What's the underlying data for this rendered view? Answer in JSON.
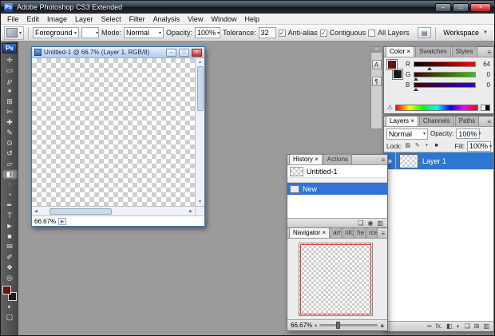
{
  "glyphs": {
    "minimize": "–",
    "maximize": "□",
    "close": "×",
    "dropdown": "▾",
    "dropdown_solid": "▼",
    "menu": "≡",
    "check": "✓",
    "warning": "⚠",
    "brushes": "▤",
    "eye": "◉",
    "status_arrow": "▶",
    "scroll_up": "▲",
    "scroll_down": "▼",
    "scroll_left": "◀",
    "scroll_right": "▶"
  },
  "window": {
    "title": "Adobe Photoshop CS3 Extended",
    "app_icon": "Ps"
  },
  "menu": {
    "items": [
      "File",
      "Edit",
      "Image",
      "Layer",
      "Select",
      "Filter",
      "Analysis",
      "View",
      "Window",
      "Help"
    ]
  },
  "options": {
    "fill_source": "Foreground",
    "mode_label": "Mode:",
    "mode_value": "Normal",
    "opacity_label": "Opacity:",
    "opacity_value": "100%",
    "tolerance_label": "Tolerance:",
    "tolerance_value": "32",
    "antialias": "Anti-alias",
    "contiguous": "Contiguous",
    "all_layers": "All Layers",
    "workspace": "Workspace"
  },
  "toolbar": {
    "logo": "Ps",
    "foreground_color": "#5e1616",
    "background_color": "#1c1c1c",
    "tools": [
      {
        "name": "move-tool",
        "glyph": "✛"
      },
      {
        "name": "marquee-tool",
        "glyph": "▭"
      },
      {
        "name": "lasso-tool",
        "glyph": "℘"
      },
      {
        "name": "magic-wand-tool",
        "glyph": "✶"
      },
      {
        "name": "crop-tool",
        "glyph": "⊞"
      },
      {
        "name": "slice-tool",
        "glyph": "✄"
      },
      {
        "name": "healing-brush-tool",
        "glyph": "✚"
      },
      {
        "name": "brush-tool",
        "glyph": "✎"
      },
      {
        "name": "clone-stamp-tool",
        "glyph": "⊙"
      },
      {
        "name": "history-brush-tool",
        "glyph": "↺"
      },
      {
        "name": "eraser-tool",
        "glyph": "▱"
      },
      {
        "name": "paint-bucket-tool",
        "glyph": "◧"
      },
      {
        "name": "blur-tool",
        "glyph": "◌"
      },
      {
        "name": "dodge-tool",
        "glyph": "◔"
      },
      {
        "name": "pen-tool",
        "glyph": "✒"
      },
      {
        "name": "type-tool",
        "glyph": "T"
      },
      {
        "name": "path-selection-tool",
        "glyph": "►"
      },
      {
        "name": "shape-tool",
        "glyph": "■"
      },
      {
        "name": "notes-tool",
        "glyph": "✉"
      },
      {
        "name": "eyedropper-tool",
        "glyph": "✐"
      },
      {
        "name": "hand-tool",
        "glyph": "❖"
      },
      {
        "name": "zoom-tool",
        "glyph": "◎"
      },
      {
        "name": "quick-mask-mode-icon",
        "glyph": "◐"
      },
      {
        "name": "screen-mode-icon",
        "glyph": "▢"
      }
    ]
  },
  "document": {
    "title": "Untitled-1 @ 66.7% (Layer 1, RGB/8)",
    "zoom": "66.67%"
  },
  "history": {
    "tab_active": "History ×",
    "tab_inactive": "Actions",
    "snapshot": "Untitled-1",
    "state": "New",
    "buttons": [
      {
        "name": "new-document-from-state-icon",
        "glyph": "❏"
      },
      {
        "name": "new-snapshot-icon",
        "glyph": "◉"
      },
      {
        "name": "delete-state-icon",
        "glyph": "▥"
      }
    ]
  },
  "navigator": {
    "tab_active": "Navigator ×",
    "tabs_truncated": [
      "am",
      "nfo",
      "he",
      "rce"
    ],
    "zoom": "66.67%",
    "zoom_out_glyph": "▴",
    "zoom_in_glyph": "▴"
  },
  "dock_strip": {
    "icons": [
      {
        "name": "collapse-dock-icon",
        "glyph": "«"
      },
      {
        "name": "character-panel-icon",
        "glyph": "A"
      },
      {
        "name": "paragraph-panel-icon",
        "glyph": "¶"
      }
    ]
  },
  "color_panel": {
    "tabs": [
      "Color ×",
      "Swatches",
      "Styles"
    ],
    "channels": [
      {
        "label": "R",
        "value": "64"
      },
      {
        "label": "G",
        "value": "0"
      },
      {
        "label": "B",
        "value": "0"
      }
    ]
  },
  "layers_panel": {
    "tabs": [
      "Layers ×",
      "Channels",
      "Paths"
    ],
    "blend_mode": "Normal",
    "opacity_label": "Opacity:",
    "opacity_value": "100%",
    "lock_label": "Lock:",
    "fill_label": "Fill:",
    "fill_value": "100%",
    "layer_name": "Layer 1",
    "locks": [
      {
        "name": "lock-transparency-icon",
        "glyph": "▨"
      },
      {
        "name": "lock-pixels-icon",
        "glyph": "✎"
      },
      {
        "name": "lock-position-icon",
        "glyph": "+"
      },
      {
        "name": "lock-all-icon",
        "glyph": "■"
      }
    ],
    "buttons": [
      {
        "name": "link-layers-icon",
        "glyph": "∞"
      },
      {
        "name": "layer-style-icon",
        "glyph": "fx."
      },
      {
        "name": "add-layer-mask-icon",
        "glyph": "◧"
      },
      {
        "name": "adjustment-layer-icon",
        "glyph": "◐"
      },
      {
        "name": "new-group-icon",
        "glyph": "❑"
      },
      {
        "name": "new-layer-icon",
        "glyph": "⊞"
      },
      {
        "name": "delete-layer-icon",
        "glyph": "▥"
      }
    ]
  }
}
